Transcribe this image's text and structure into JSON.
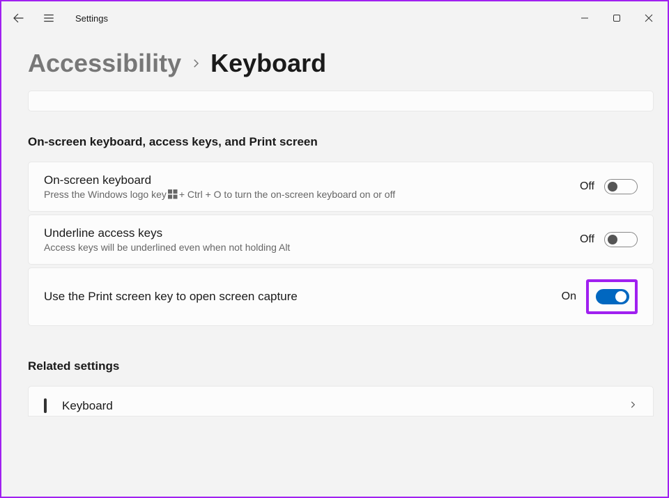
{
  "app": {
    "title": "Settings"
  },
  "breadcrumb": {
    "parent": "Accessibility",
    "current": "Keyboard"
  },
  "section": {
    "header": "On-screen keyboard, access keys, and Print screen"
  },
  "settings": {
    "osk": {
      "title": "On-screen keyboard",
      "desc_pre": "Press the Windows logo key ",
      "desc_post": " + Ctrl + O to turn the on-screen keyboard on or off",
      "state_label": "Off",
      "on": false
    },
    "underline": {
      "title": "Underline access keys",
      "desc": "Access keys will be underlined even when not holding Alt",
      "state_label": "Off",
      "on": false
    },
    "prtscn": {
      "title": "Use the Print screen key to open screen capture",
      "state_label": "On",
      "on": true
    }
  },
  "related": {
    "header": "Related settings",
    "keyboard_label": "Keyboard"
  },
  "colors": {
    "accent": "#0067c0",
    "highlight": "#a020f0"
  },
  "icons": {
    "back": "back-arrow-icon",
    "menu": "hamburger-icon",
    "minimize": "minimize-icon",
    "maximize": "maximize-icon",
    "close": "close-icon",
    "chevron_right": "chevron-right-icon",
    "keyboard": "keyboard-icon",
    "winkey": "windows-logo-icon"
  }
}
